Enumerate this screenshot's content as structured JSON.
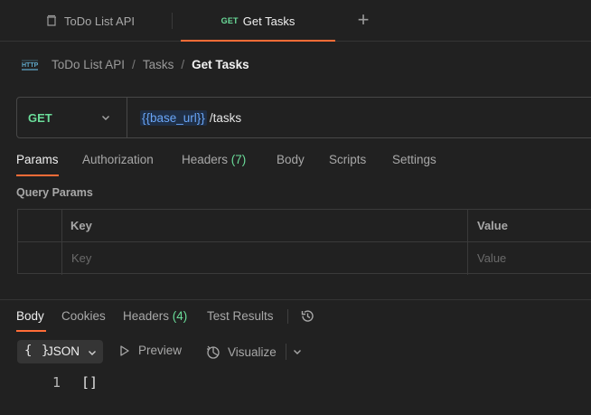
{
  "tabs": [
    {
      "label": "ToDo List API",
      "icon": "collection-icon"
    },
    {
      "method": "GET",
      "label": "Get Tasks",
      "active": true
    }
  ],
  "breadcrumb": {
    "icon": "http-icon",
    "items": [
      "ToDo List API",
      "Tasks"
    ],
    "current": "Get Tasks"
  },
  "request": {
    "method": "GET",
    "url_variable": "{{base_url}}",
    "url_path": "/tasks"
  },
  "request_tabs": {
    "params": "Params",
    "authorization": "Authorization",
    "headers": "Headers",
    "headers_count": "(7)",
    "body": "Body",
    "scripts": "Scripts",
    "settings": "Settings"
  },
  "query_params": {
    "title": "Query Params",
    "headers": {
      "key": "Key",
      "value": "Value"
    },
    "placeholders": {
      "key": "Key",
      "value": "Value"
    }
  },
  "response_tabs": {
    "body": "Body",
    "cookies": "Cookies",
    "headers": "Headers",
    "headers_count": "(4)",
    "test_results": "Test Results"
  },
  "response_toolbar": {
    "format_braces": "{ }",
    "format": "JSON",
    "preview": "Preview",
    "visualize": "Visualize"
  },
  "response_body": {
    "line_number": "1",
    "content": "[]"
  },
  "colors": {
    "accent": "#ff6c37",
    "method_get": "#6bdd9a",
    "variable": "#6aa6f8",
    "background": "#212121"
  }
}
